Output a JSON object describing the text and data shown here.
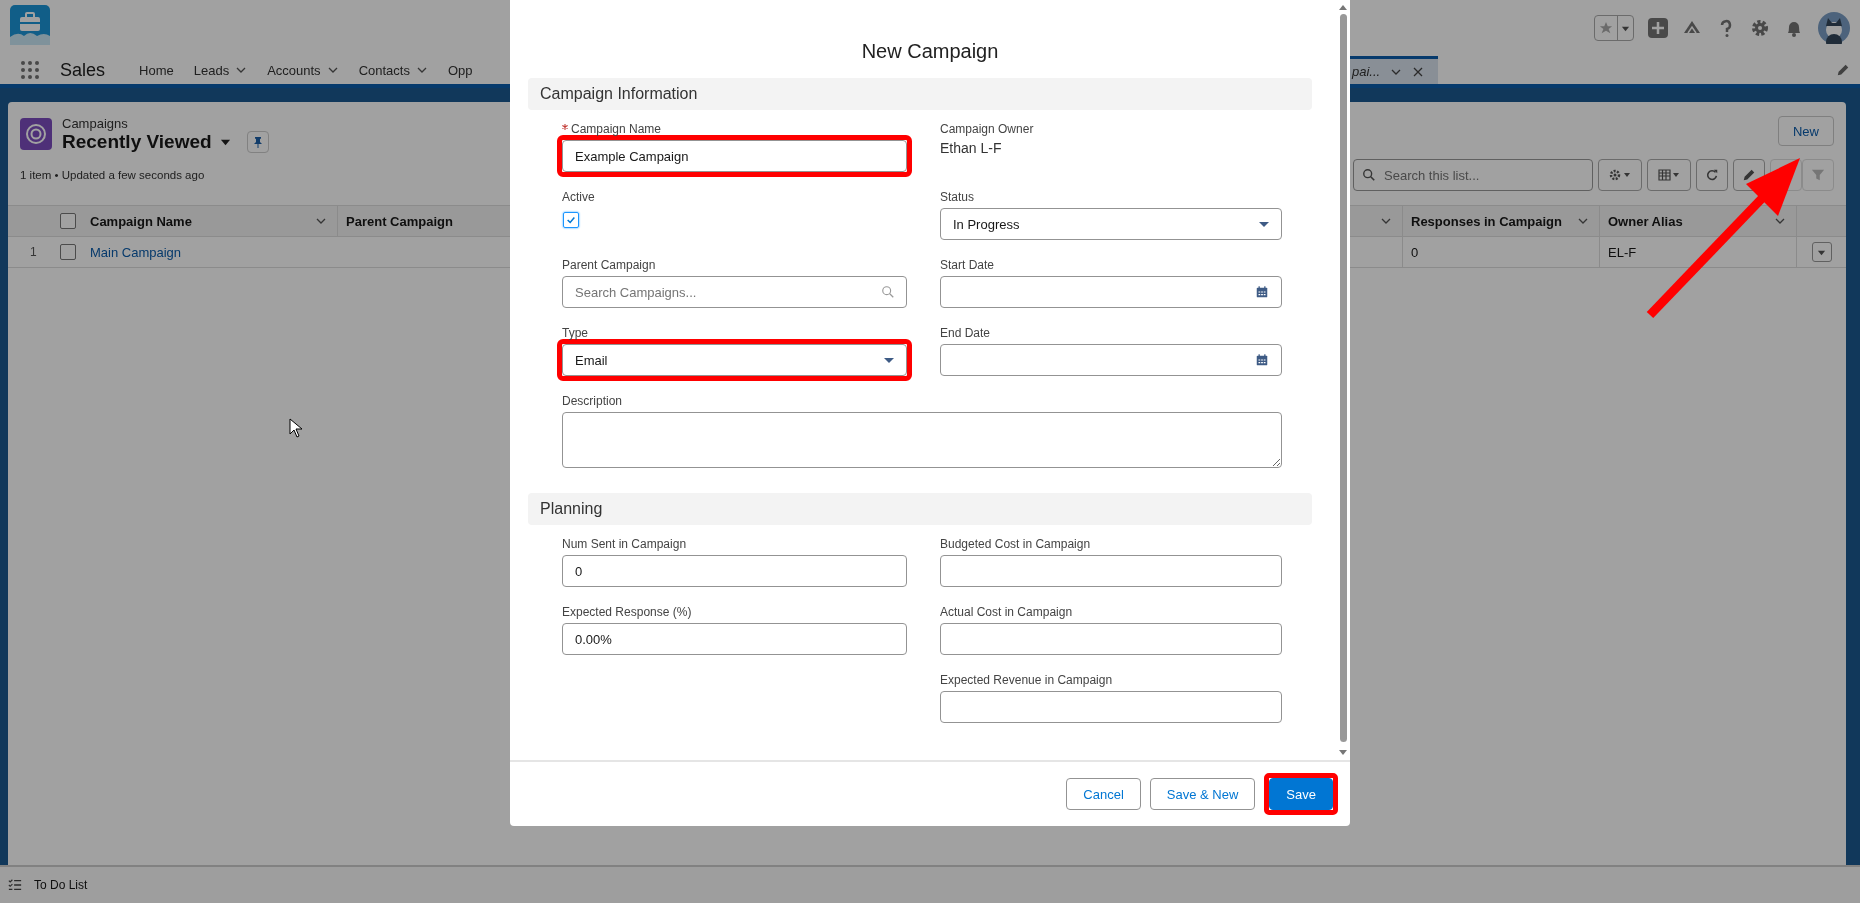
{
  "app": {
    "name": "Sales"
  },
  "nav_tabs": [
    {
      "label": "Home",
      "has_menu": false,
      "selected": false
    },
    {
      "label": "Leads",
      "has_menu": true,
      "selected": false
    },
    {
      "label": "Accounts",
      "has_menu": true,
      "selected": false
    },
    {
      "label": "Contacts",
      "has_menu": true,
      "selected": false
    },
    {
      "label": "Opp",
      "has_menu": false,
      "selected": false
    }
  ],
  "open_tab": {
    "label": "pai...",
    "selected": true
  },
  "list_view": {
    "object": "Campaigns",
    "view_name": "Recently Viewed",
    "status": "1 item • Updated a few seconds ago",
    "new_button": "New",
    "search_placeholder": "Search this list...",
    "all_selected": false,
    "columns_left": [
      "Campaign Name",
      "Parent Campaign"
    ],
    "columns_right": [
      "Responses in Campaign",
      "Owner Alias"
    ],
    "rows": [
      {
        "number": "1",
        "name": "Main Campaign",
        "responses": "0",
        "owner_alias": "EL-F",
        "selected": false
      }
    ]
  },
  "modal": {
    "title": "New Campaign",
    "sections": [
      {
        "title": "Campaign Information",
        "rows": [
          [
            {
              "label": "Campaign Name",
              "kind": "text",
              "required": true,
              "value": "Example Campaign",
              "highlighted": true
            },
            {
              "label": "Campaign Owner",
              "kind": "readonly",
              "value": "Ethan L-F"
            }
          ],
          [
            {
              "label": "Active",
              "kind": "checkbox",
              "checked": true
            },
            {
              "label": "Status",
              "kind": "picklist",
              "value": "In Progress"
            }
          ],
          [
            {
              "label": "Parent Campaign",
              "kind": "lookup",
              "placeholder": "Search Campaigns..."
            },
            {
              "label": "Start Date",
              "kind": "date"
            }
          ],
          [
            {
              "label": "Type",
              "kind": "picklist",
              "value": "Email",
              "highlighted": true
            },
            {
              "label": "End Date",
              "kind": "date"
            }
          ],
          [
            {
              "label": "Description",
              "kind": "textarea"
            }
          ]
        ]
      },
      {
        "title": "Planning",
        "rows": [
          [
            {
              "label": "Num Sent in Campaign",
              "kind": "text",
              "value": "0"
            },
            {
              "label": "Budgeted Cost in Campaign",
              "kind": "text"
            }
          ],
          [
            {
              "label": "Expected Response (%)",
              "kind": "text",
              "value": "0.00%"
            },
            {
              "label": "Actual Cost in Campaign",
              "kind": "text"
            }
          ],
          [
            null,
            {
              "label": "Expected Revenue in Campaign",
              "kind": "text"
            }
          ]
        ]
      }
    ],
    "buttons": [
      {
        "label": "Cancel",
        "kind": "neutral",
        "highlighted": false
      },
      {
        "label": "Save & New",
        "kind": "neutral",
        "highlighted": false
      },
      {
        "label": "Save",
        "kind": "brand",
        "highlighted": true
      }
    ]
  },
  "utility_bar": {
    "label": "To Do List"
  },
  "pointer_arrow": true
}
